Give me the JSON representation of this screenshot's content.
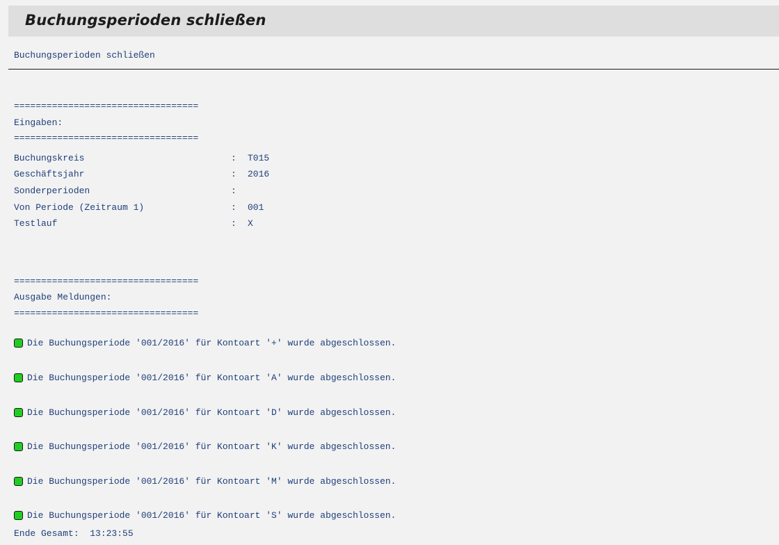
{
  "title": "Buchungsperioden schließen",
  "report_header": "Buchungsperioden schließen",
  "separator": "==================================",
  "inputs": {
    "heading": "Eingaben:",
    "fields": [
      {
        "label": "Buchungskreis",
        "colon": ":",
        "value": "T015"
      },
      {
        "label": "Geschäftsjahr",
        "colon": ":",
        "value": "2016"
      },
      {
        "label": "Sonderperioden",
        "colon": ":",
        "value": ""
      },
      {
        "label": "Von Periode (Zeitraum 1)",
        "colon": ":",
        "value": "001"
      },
      {
        "label": "Testlauf",
        "colon": ":",
        "value": "X"
      }
    ]
  },
  "output": {
    "heading": "Ausgabe Meldungen:",
    "status_color": "#22cc22",
    "messages": [
      {
        "icon": "green-status-icon",
        "text": "Die Buchungsperiode '001/2016' für Kontoart '+' wurde abgeschlossen."
      },
      {
        "icon": "green-status-icon",
        "text": "Die Buchungsperiode '001/2016' für Kontoart 'A' wurde abgeschlossen."
      },
      {
        "icon": "green-status-icon",
        "text": "Die Buchungsperiode '001/2016' für Kontoart 'D' wurde abgeschlossen."
      },
      {
        "icon": "green-status-icon",
        "text": "Die Buchungsperiode '001/2016' für Kontoart 'K' wurde abgeschlossen."
      },
      {
        "icon": "green-status-icon",
        "text": "Die Buchungsperiode '001/2016' für Kontoart 'M' wurde abgeschlossen."
      },
      {
        "icon": "green-status-icon",
        "text": "Die Buchungsperiode '001/2016' für Kontoart 'S' wurde abgeschlossen."
      }
    ]
  },
  "footer": {
    "end_text": "Ende Gesamt:  13:23:55"
  }
}
